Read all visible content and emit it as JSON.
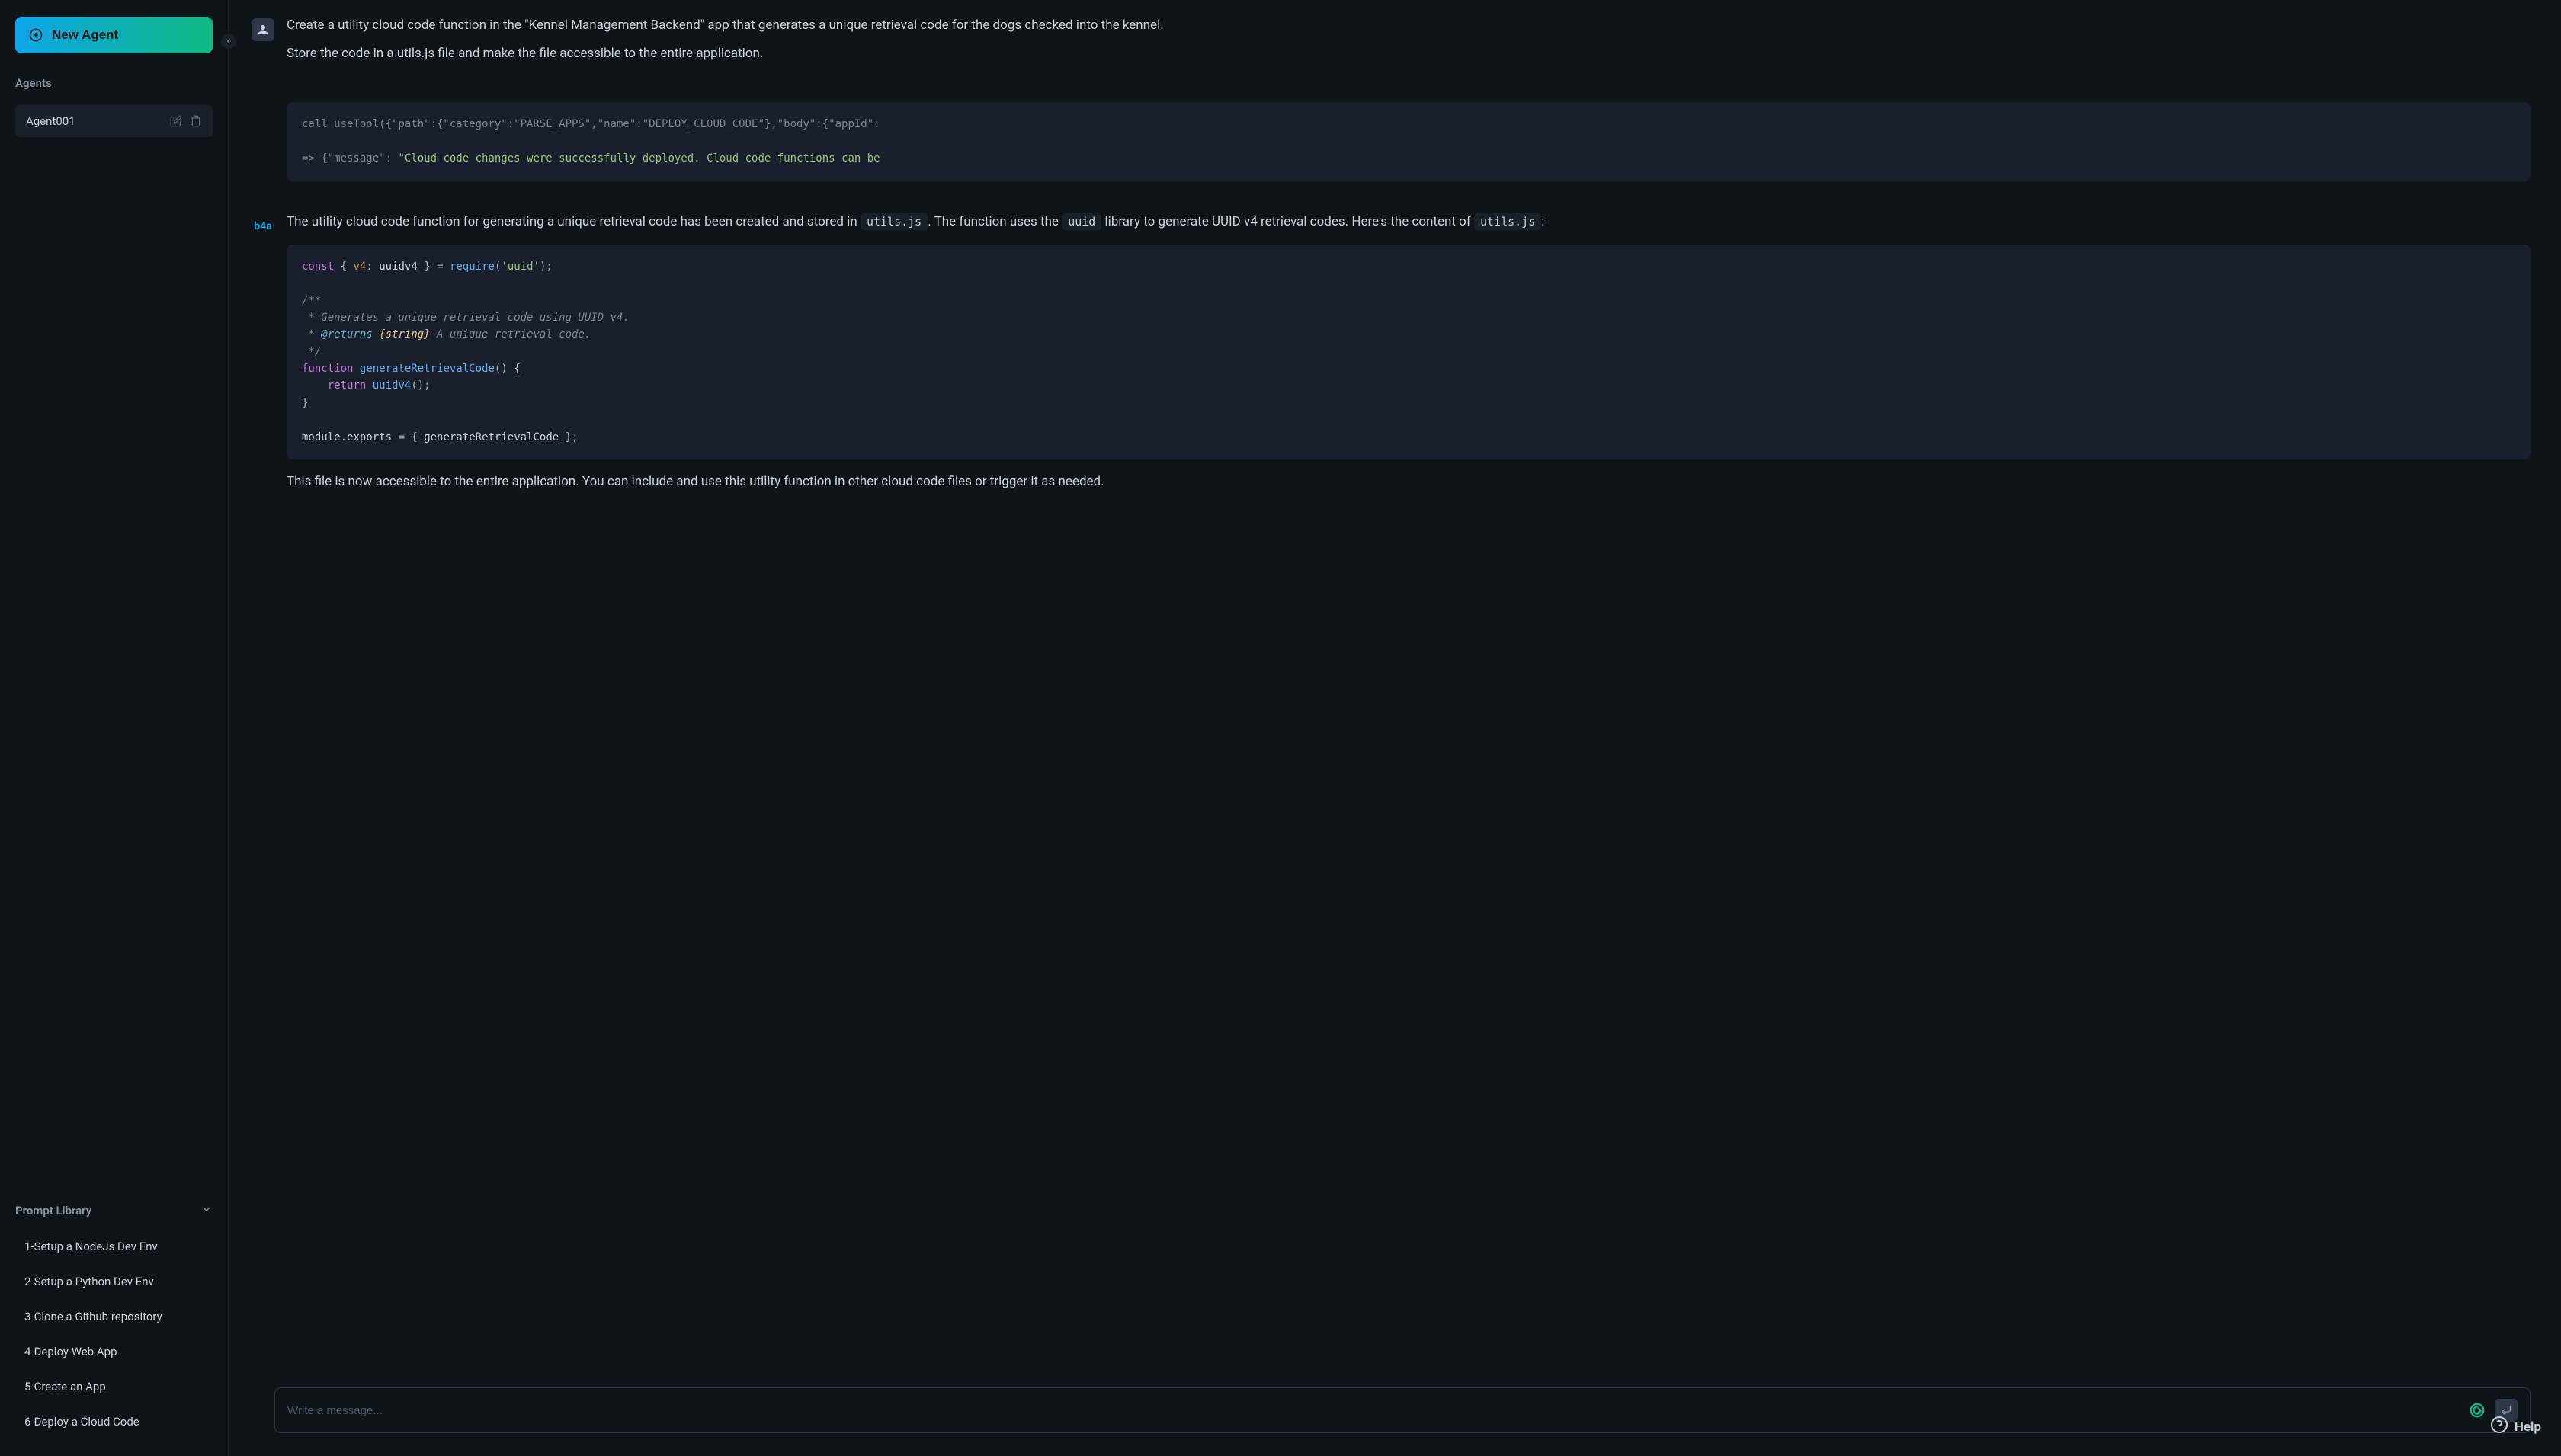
{
  "sidebar": {
    "new_agent_label": "New Agent",
    "agents_title": "Agents",
    "agents": [
      {
        "name": "Agent001"
      }
    ],
    "prompt_library_title": "Prompt Library",
    "prompts": [
      {
        "label": "1-Setup a NodeJs Dev Env"
      },
      {
        "label": "2-Setup a Python Dev Env"
      },
      {
        "label": "3-Clone a Github repository"
      },
      {
        "label": "4-Deploy Web App"
      },
      {
        "label": "5-Create an App"
      },
      {
        "label": "6-Deploy a Cloud Code"
      }
    ]
  },
  "chat": {
    "user_message": {
      "line1": "Create a utility cloud code function in the \"Kennel Management Backend\" app that generates a unique retrieval code for the dogs checked into the kennel.",
      "line2": "Store the code in a utils.js file and make the file accessible to the entire application."
    },
    "code_block_1": {
      "line1": "call useTool({\"path\":{\"category\":\"PARSE_APPS\",\"name\":\"DEPLOY_CLOUD_CODE\"},\"body\":{\"appId\":",
      "line2": "=> {\"message\": \"Cloud code changes were successfully deployed. Cloud code functions can be"
    },
    "bot_message": {
      "para1": "The utility cloud code function for generating a unique retrieval code has been created and stored in ",
      "code1": "utils.js",
      "para1b": ". The function uses the ",
      "code2": "uuid",
      "para1c": " library to generate UUID v4 retrieval codes. Here's the content of ",
      "code3": "utils.js",
      "para1d": ":",
      "para2": "This file is now accessible to the entire application. You can include and use this utility function in other cloud code files or trigger it as needed."
    },
    "code_block_2": {
      "raw": "const { v4: uuidv4 } = require('uuid');\n\n/**\n * Generates a unique retrieval code using UUID v4.\n * @returns {string} A unique retrieval code.\n */\nfunction generateRetrievalCode() {\n    return uuidv4();\n}\n\nmodule.exports = { generateRetrievalCode };"
    },
    "bot_name": "b4a"
  },
  "input": {
    "placeholder": "Write a message..."
  },
  "help": {
    "label": "Help"
  }
}
